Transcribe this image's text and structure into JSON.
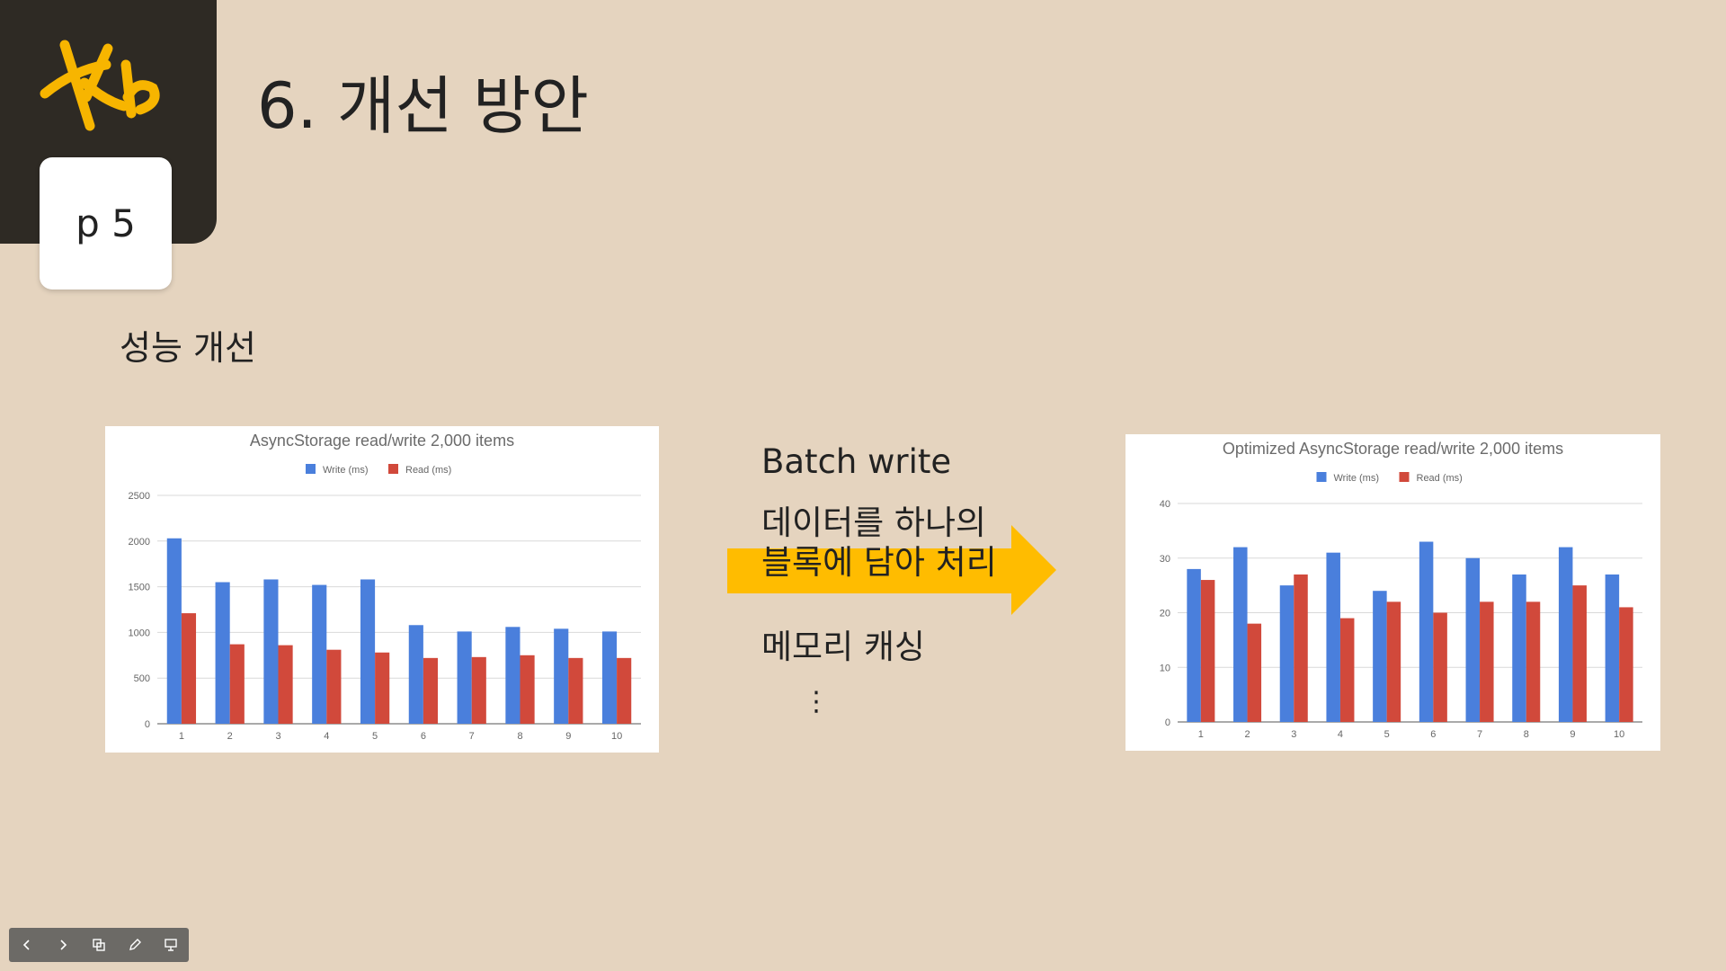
{
  "slide": {
    "title": "6. 개선 방안",
    "page_badge": "p 5",
    "subtitle": "성능 개선"
  },
  "logo": {
    "text": "Kb",
    "color": "#f7b500"
  },
  "bullets": {
    "item1": "Batch write",
    "item2": "데이터를 하나의 블록에 담아 처리",
    "item3": "메모리 캐싱",
    "ellipsis": "⋮"
  },
  "arrow_color": "#ffbc00",
  "colors": {
    "write": "#4a7fdc",
    "read": "#d1493b"
  },
  "toolbar": {
    "prev_icon": "chevron-left-icon",
    "next_icon": "chevron-right-icon",
    "slides_icon": "slides-icon",
    "pen_icon": "pen-icon",
    "presenter_icon": "presenter-icon"
  },
  "chart_data": [
    {
      "type": "bar",
      "title": "AsyncStorage read/write 2,000 items",
      "categories": [
        "1",
        "2",
        "3",
        "4",
        "5",
        "6",
        "7",
        "8",
        "9",
        "10"
      ],
      "series": [
        {
          "name": "Write (ms)",
          "values": [
            2030,
            1550,
            1580,
            1520,
            1580,
            1080,
            1010,
            1060,
            1040,
            1010
          ]
        },
        {
          "name": "Read (ms)",
          "values": [
            1210,
            870,
            860,
            810,
            780,
            720,
            730,
            750,
            720,
            720
          ]
        }
      ],
      "yticks": [
        0,
        500,
        1000,
        1500,
        2000,
        2500
      ],
      "ylim": [
        0,
        2500
      ],
      "grid": true,
      "legend": "top"
    },
    {
      "type": "bar",
      "title": "Optimized AsyncStorage read/write 2,000 items",
      "categories": [
        "1",
        "2",
        "3",
        "4",
        "5",
        "6",
        "7",
        "8",
        "9",
        "10"
      ],
      "series": [
        {
          "name": "Write (ms)",
          "values": [
            28,
            32,
            25,
            31,
            24,
            33,
            30,
            27,
            32,
            27
          ]
        },
        {
          "name": "Read (ms)",
          "values": [
            26,
            18,
            27,
            19,
            22,
            20,
            22,
            22,
            25,
            21
          ]
        }
      ],
      "yticks": [
        0,
        10,
        20,
        30,
        40
      ],
      "ylim": [
        0,
        40
      ],
      "grid": true,
      "legend": "top"
    }
  ]
}
